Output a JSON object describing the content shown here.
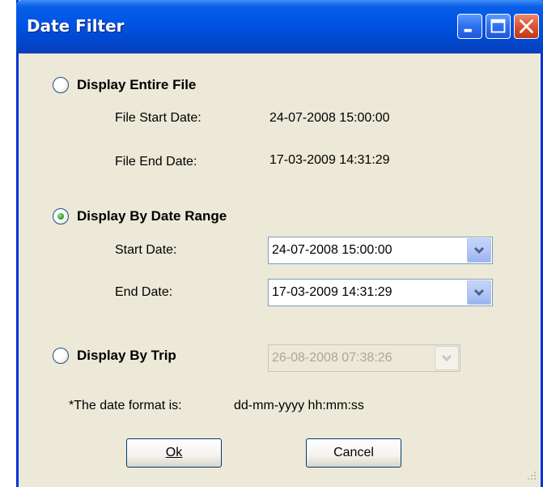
{
  "window": {
    "title": "Date Filter",
    "controls": {
      "minimize": "minimize-icon",
      "maximize": "maximize-icon",
      "close": "close-icon"
    }
  },
  "options": {
    "entire_file": {
      "label": "Display Entire File",
      "selected": false,
      "start_label": "File Start Date:",
      "start_value": "24-07-2008 15:00:00",
      "end_label": "File End Date:",
      "end_value": "17-03-2009 14:31:29"
    },
    "date_range": {
      "label": "Display By Date Range",
      "selected": true,
      "start_label": "Start Date:",
      "start_value": "24-07-2008 15:00:00",
      "end_label": "End Date:",
      "end_value": "17-03-2009 14:31:29"
    },
    "trip": {
      "label": "Display By Trip",
      "selected": false,
      "value": "26-08-2008 07:38:26"
    }
  },
  "note": {
    "label": "*The date format is:",
    "format": "dd-mm-yyyy  hh:mm:ss"
  },
  "buttons": {
    "ok_label": "Ok",
    "cancel_label": "Cancel"
  },
  "colors": {
    "titlebar": "#0055E5",
    "dialog_bg": "#ECE9D8",
    "radio_selected": "#21A121"
  }
}
